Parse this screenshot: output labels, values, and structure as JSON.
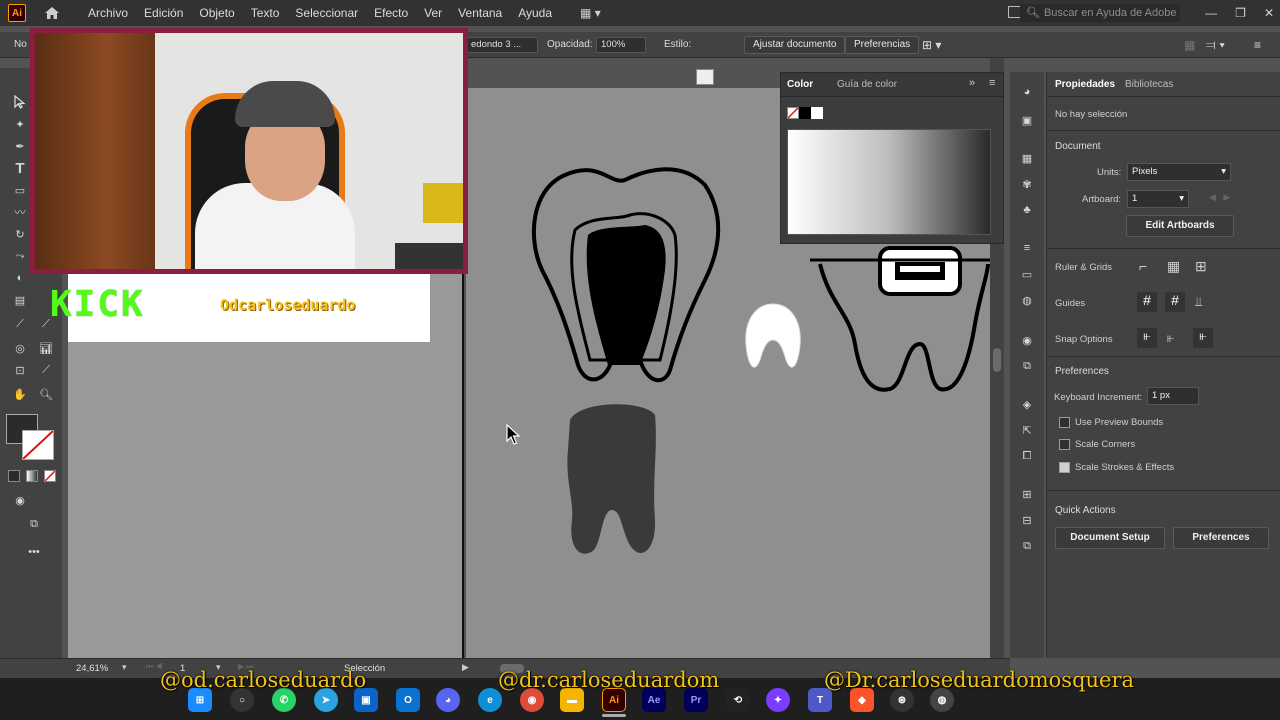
{
  "app": {
    "logo": "Ai"
  },
  "menu": {
    "items": [
      "Archivo",
      "Edición",
      "Objeto",
      "Texto",
      "Seleccionar",
      "Efecto",
      "Ver",
      "Ventana",
      "Ayuda"
    ]
  },
  "help_search": {
    "placeholder": "Buscar en Ayuda de Adobe"
  },
  "controlbar": {
    "selection": "No",
    "stroke_style": "edondo 3 ...",
    "opacity_label": "Opacidad:",
    "opacity_value": "100%",
    "style_label": "Estilo:",
    "fit_button": "Ajustar documento",
    "prefs_button": "Preferencias"
  },
  "color_panel": {
    "tab_color": "Color",
    "tab_guide": "Guía de color"
  },
  "properties": {
    "tab_properties": "Propiedades",
    "tab_libraries": "Bibliotecas",
    "no_selection": "No hay selección",
    "document_title": "Document",
    "units_label": "Units:",
    "units_value": "Pixels",
    "artboard_label": "Artboard:",
    "artboard_value": "1",
    "edit_artboards": "Edit Artboards",
    "ruler_grids": "Ruler & Grids",
    "guides": "Guides",
    "snap_options": "Snap Options",
    "preferences_title": "Preferences",
    "keyboard_increment_label": "Keyboard Increment:",
    "keyboard_increment_value": "1 px",
    "use_preview_bounds": "Use Preview Bounds",
    "scale_corners": "Scale Corners",
    "scale_strokes": "Scale Strokes & Effects",
    "quick_actions": "Quick Actions",
    "document_setup": "Document Setup",
    "preferences_button": "Preferences"
  },
  "status": {
    "zoom": "24,61%",
    "artboard": "1",
    "tool": "Selección"
  },
  "banner": {
    "kick": "KICK",
    "handle": "Odcarloseduardo"
  },
  "overlay": {
    "handle1": "@od.carloseduardo",
    "handle2": "@dr.carloseduardom",
    "handle3": "@Dr.carloseduardomosquera"
  },
  "taskbar": {
    "ae": "Ae",
    "pr": "Pr",
    "ai": "Ai"
  },
  "colors": {
    "accent_ai": "#ff9a00",
    "kick_green": "#53fc18",
    "webcam_frame": "#8b1e3f",
    "overlay_text": "#f2c21b"
  }
}
